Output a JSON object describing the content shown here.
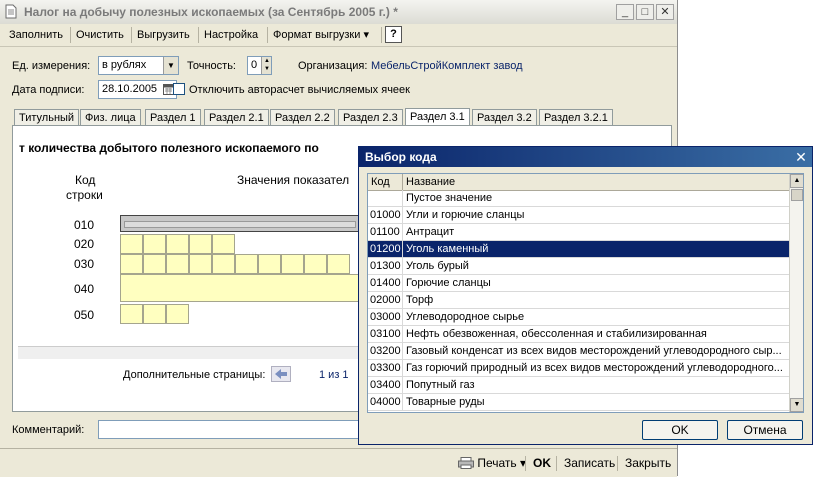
{
  "window": {
    "title": "Налог на добычу полезных ископаемых (за Сентябрь 2005 г.) *",
    "minimize": "_",
    "maximize": "□",
    "close": "✕"
  },
  "toolbar": {
    "fill": "Заполнить",
    "clear": "Очистить",
    "export": "Выгрузить",
    "settings": "Настройка",
    "export_format": "Формат выгрузки",
    "export_format_arrow": "▾",
    "help": "?"
  },
  "form": {
    "units_label": "Ед. измерения:",
    "units_value": "в рублях",
    "precision_label": "Точность:",
    "precision_value": "0",
    "org_label": "Организация:",
    "org_value": "МебельСтройКомплект завод",
    "sign_date_label": "Дата подписи:",
    "sign_date_value": "28.10.2005",
    "autocalc_label": "Отключить авторасчет вычисляемых ячеек"
  },
  "tabs": [
    "Титульный",
    "Физ. лица",
    "Раздел 1",
    "Раздел 2.1",
    "Раздел 2.2",
    "Раздел 2.3",
    "Раздел 3.1",
    "Раздел 3.2",
    "Раздел 3.2.1"
  ],
  "active_tab": "Раздел 3.1",
  "section": {
    "heading": "т количества добытого полезного ископаемого по",
    "col_code": "Код",
    "col_row": "строки",
    "col_values": "Значения показател",
    "rows": [
      "010",
      "020",
      "030",
      "040",
      "050"
    ]
  },
  "pager": {
    "label": "Дополнительные страницы:",
    "value": "1 из 1"
  },
  "comment_label": "Комментарий:",
  "status_bar": {
    "print": "Печать",
    "ok": "OK",
    "save": "Записать",
    "close": "Закрыть"
  },
  "dialog": {
    "title": "Выбор кода",
    "close": "✕",
    "columns": {
      "code": "Код",
      "name": "Название"
    },
    "items": [
      {
        "code": "",
        "name": "Пустое значение"
      },
      {
        "code": "01000",
        "name": "Угли и горючие сланцы"
      },
      {
        "code": "01100",
        "name": "Антрацит"
      },
      {
        "code": "01200",
        "name": "Уголь каменный"
      },
      {
        "code": "01300",
        "name": "Уголь бурый"
      },
      {
        "code": "01400",
        "name": "Горючие сланцы"
      },
      {
        "code": "02000",
        "name": "Торф"
      },
      {
        "code": "03000",
        "name": "Углеводородное сырье"
      },
      {
        "code": "03100",
        "name": "Нефть обезвоженная, обессоленная и стабилизированная"
      },
      {
        "code": "03200",
        "name": "Газовый конденсат из всех видов месторождений углеводородного сыр..."
      },
      {
        "code": "03300",
        "name": "Газ горючий природный из всех видов месторождений углеводородного..."
      },
      {
        "code": "03400",
        "name": "Попутный газ"
      },
      {
        "code": "04000",
        "name": "Товарные руды"
      }
    ],
    "selected_code": "01200",
    "ok": "OK",
    "cancel": "Отмена"
  },
  "colors": {
    "selection": "#0a246a",
    "input_cell": "#ffffc0",
    "window_bg": "#ece9d8"
  }
}
